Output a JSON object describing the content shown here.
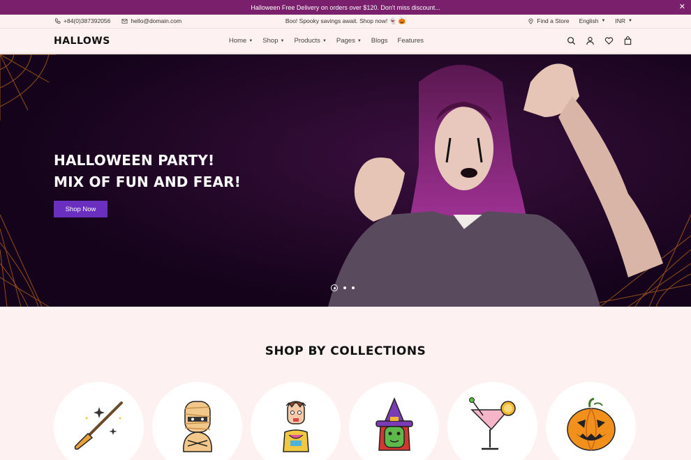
{
  "announcement": {
    "text": "Halloween Free Delivery on orders over $120. Don't miss discount...",
    "close": "✕"
  },
  "topbar": {
    "phone": "+84(0)387392056",
    "email": "hello@domain.com",
    "promo": "Boo! Spooky savings await. Shop now! 👻 🎃",
    "find_store": "Find a Store",
    "language": "English",
    "currency": "INR"
  },
  "header": {
    "logo": "HALLOWS",
    "nav": [
      {
        "label": "Home",
        "dropdown": true
      },
      {
        "label": "Shop",
        "dropdown": true
      },
      {
        "label": "Products",
        "dropdown": true
      },
      {
        "label": "Pages",
        "dropdown": true
      },
      {
        "label": "Blogs",
        "dropdown": false
      },
      {
        "label": "Features",
        "dropdown": false
      }
    ]
  },
  "hero": {
    "line1": "HALLOWEEN PARTY!",
    "line2": "MIX OF FUN AND FEAR!",
    "button": "Shop Now",
    "slides": 3,
    "active_slide": 1
  },
  "collections": {
    "title": "SHOP BY COLLECTIONS",
    "items": [
      {
        "icon": "witch-broom-icon"
      },
      {
        "icon": "mummy-icon"
      },
      {
        "icon": "zombie-icon"
      },
      {
        "icon": "witch-icon"
      },
      {
        "icon": "cocktail-icon"
      },
      {
        "icon": "pumpkin-icon"
      }
    ]
  },
  "colors": {
    "brand": "#7a1f6b",
    "button": "#6b2fc0",
    "page_bg": "#fdf1f1"
  }
}
